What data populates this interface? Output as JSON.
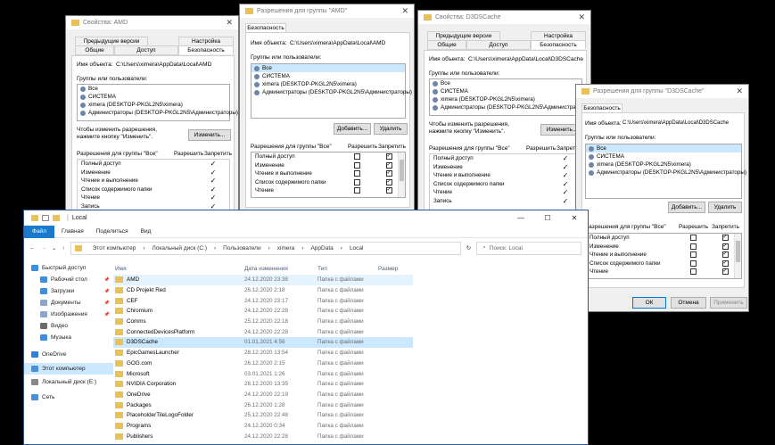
{
  "win1": {
    "title": "Свойства: AMD",
    "tabs_top": [
      "Предыдущие версии",
      "Настройка"
    ],
    "tabs_bottom": [
      "Общие",
      "Доступ",
      "Безопасность"
    ],
    "object_label": "Имя объекта:",
    "object": "C:\\Users\\ximera\\AppData\\Local\\AMD",
    "groups_label": "Группы или пользователи:",
    "users": [
      "Все",
      "СИСТЕМА",
      "ximera (DESKTOP-PKGL2N5\\ximera)",
      "Администраторы (DESKTOP-PKGL2N5\\Администраторы)"
    ],
    "hint": "Чтобы изменить разрешения, нажмите кнопку \"Изменить\".",
    "change_btn": "Изменить...",
    "perm_header": "Разрешения для группы \"Все\"",
    "allow": "Разрешить",
    "deny": "Запретить",
    "perms": [
      "Полный доступ",
      "Изменение",
      "Чтение и выполнение",
      "Список содержимого папки",
      "Чтение",
      "Запись"
    ]
  },
  "win2": {
    "title": "Разрешения для группы \"AMD\"",
    "tab": "Безопасность",
    "object_label": "Имя объекта:",
    "object": "C:\\Users\\ximera\\AppData\\Local\\AMD",
    "groups_label": "Группы или пользователи:",
    "users": [
      "Все",
      "СИСТЕМА",
      "ximera (DESKTOP-PKGL2N5\\ximera)",
      "Администраторы (DESKTOP-PKGL2N5\\Администраторы)"
    ],
    "add_btn": "Добавить...",
    "remove_btn": "Удалить",
    "perm_header": "Разрешения для группы \"Все\"",
    "allow": "Разрешить",
    "deny": "Запретить",
    "perms": [
      "Полный доступ",
      "Изменение",
      "Чтение и выполнение",
      "Список содержимого папки",
      "Чтение"
    ]
  },
  "win3": {
    "title": "Свойства: D3DSCache",
    "tabs_top": [
      "Предыдущие версии",
      "Настройка"
    ],
    "tabs_bottom": [
      "Общие",
      "Доступ",
      "Безопасность"
    ],
    "object_label": "Имя объекта:",
    "object": "C:\\Users\\ximera\\AppData\\Local\\D3DSCache",
    "groups_label": "Группы или пользователи:",
    "users": [
      "Все",
      "СИСТЕМА",
      "ximera (DESKTOP-PKGL2N5\\ximera)",
      "Администраторы (DESKTOP-PKGL2N5\\Администраторы)"
    ],
    "hint": "Чтобы изменить разрешения, нажмите кнопку \"Изменить\".",
    "change_btn": "Изменить...",
    "perm_header": "Разрешения для группы \"Все\"",
    "allow": "Разрешить",
    "deny": "Запретить",
    "perms": [
      "Полный доступ",
      "Изменение",
      "Чтение и выполнение",
      "Список содержимого папки",
      "Чтение",
      "Запись"
    ]
  },
  "win4": {
    "title": "Разрешения для группы \"D3DSCache\"",
    "tab": "Безопасность",
    "object_label": "Имя объекта:",
    "object": "C:\\Users\\ximera\\AppData\\Local\\D3DSCache",
    "groups_label": "Группы или пользователи:",
    "users": [
      "Все",
      "СИСТЕМА",
      "ximera (DESKTOP-PKGL2N5\\ximera)",
      "Администраторы (DESKTOP-PKGL2N5\\Администраторы)"
    ],
    "add_btn": "Добавить...",
    "remove_btn": "Удалить",
    "perm_header": "Разрешения для группы \"Все\"",
    "allow": "Разрешить",
    "deny": "Запретить",
    "perms": [
      "Полный доступ",
      "Изменение",
      "Чтение и выполнение",
      "Список содержимого папки",
      "Чтение"
    ],
    "ok": "ОК",
    "cancel": "Отмена",
    "apply": "Применить"
  },
  "explorer": {
    "title": "Local",
    "ribbon": {
      "file": "Файл",
      "tabs": [
        "Главная",
        "Поделиться",
        "Вид"
      ]
    },
    "path": [
      "Этот компьютер",
      "Локальный диск (C:)",
      "Пользователи",
      "ximera",
      "AppData",
      "Local"
    ],
    "search_placeholder": "Поиск: Local",
    "columns": [
      "Имя",
      "Дата изменения",
      "Тип",
      "Размер"
    ],
    "nav": [
      {
        "label": "Быстрый доступ",
        "icon": "star-icon",
        "color": "#3c8ee0"
      },
      {
        "label": "Рабочий стол",
        "icon": "desktop-icon",
        "color": "#3c8ee0"
      },
      {
        "label": "Загрузки",
        "icon": "download-icon",
        "color": "#3c8ee0"
      },
      {
        "label": "Документы",
        "icon": "documents-icon",
        "color": "#8aa6c8"
      },
      {
        "label": "Изображения",
        "icon": "pictures-icon",
        "color": "#8aa6c8"
      },
      {
        "label": "Видео",
        "icon": "video-icon",
        "color": "#6a6a6a"
      },
      {
        "label": "Музыка",
        "icon": "music-icon",
        "color": "#3c8ee0"
      },
      {
        "label": "OneDrive",
        "icon": "onedrive-icon",
        "color": "#2f7fd4"
      },
      {
        "label": "Этот компьютер",
        "icon": "computer-icon",
        "color": "#4b8fd6"
      },
      {
        "label": "Локальный диск (E:)",
        "icon": "drive-icon",
        "color": "#888888"
      },
      {
        "label": "Сеть",
        "icon": "network-icon",
        "color": "#4b8fd6"
      }
    ],
    "files": [
      {
        "name": "AMD",
        "date": "24.12.2020 23:38",
        "type": "Папка с файлами"
      },
      {
        "name": "CD Projekt Red",
        "date": "26.12.2020 2:18",
        "type": "Папка с файлами"
      },
      {
        "name": "CEF",
        "date": "24.12.2020 23:17",
        "type": "Папка с файлами"
      },
      {
        "name": "Chromium",
        "date": "24.12.2020 22:28",
        "type": "Папка с файлами"
      },
      {
        "name": "Comms",
        "date": "25.12.2020 22:18",
        "type": "Папка с файлами"
      },
      {
        "name": "ConnectedDevicesPlatform",
        "date": "24.12.2020 22:28",
        "type": "Папка с файлами"
      },
      {
        "name": "D3DSCache",
        "date": "01.01.2021 4:56",
        "type": "Папка с файлами"
      },
      {
        "name": "EpicGamesLauncher",
        "date": "28.12.2020 13:54",
        "type": "Папка с файлами"
      },
      {
        "name": "GOG.com",
        "date": "26.12.2020 2:15",
        "type": "Папка с файлами"
      },
      {
        "name": "Microsoft",
        "date": "03.01.2021 1:26",
        "type": "Папка с файлами"
      },
      {
        "name": "NVIDIA Corporation",
        "date": "28.12.2020 13:35",
        "type": "Папка с файлами"
      },
      {
        "name": "OneDrive",
        "date": "24.12.2020 22:19",
        "type": "Папка с файлами"
      },
      {
        "name": "Packages",
        "date": "26.12.2020 1:28",
        "type": "Папка с файлами"
      },
      {
        "name": "PlaceholderTileLogoFolder",
        "date": "25.12.2020 22:48",
        "type": "Папка с файлами"
      },
      {
        "name": "Programs",
        "date": "24.12.2020 0:34",
        "type": "Папка с файлами"
      },
      {
        "name": "Publishers",
        "date": "24.12.2020 22:28",
        "type": "Папка с файлами"
      }
    ]
  }
}
